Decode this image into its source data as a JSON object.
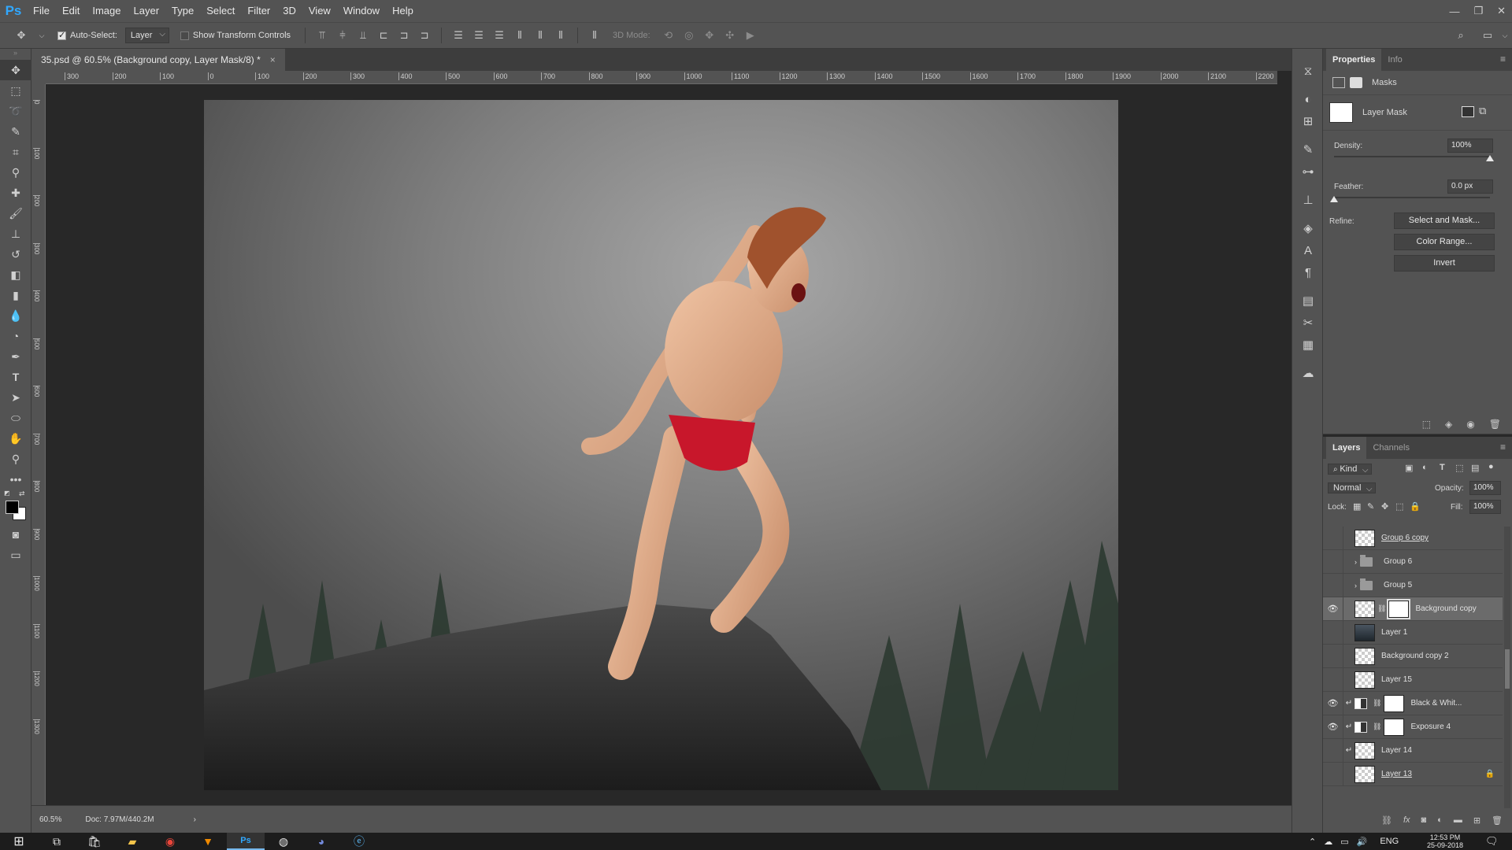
{
  "app": {
    "logo": "Ps",
    "window_controls": [
      "—",
      "❐",
      "✕"
    ]
  },
  "menu": [
    "File",
    "Edit",
    "Image",
    "Layer",
    "Type",
    "Select",
    "Filter",
    "3D",
    "View",
    "Window",
    "Help"
  ],
  "options": {
    "auto_select_label": "Auto-Select:",
    "auto_select_checked": true,
    "auto_select_target": "Layer",
    "show_transform_label": "Show Transform Controls",
    "show_transform_checked": false,
    "mode_3d_label": "3D Mode:"
  },
  "document": {
    "tab_title": "35.psd @ 60.5% (Background copy, Layer Mask/8) *",
    "close_glyph": "×",
    "zoom": "60.5%",
    "doc_size": "Doc: 7.97M/440.2M",
    "status_arrow": "›"
  },
  "ruler_h_labels": [
    "300",
    "200",
    "100",
    "0",
    "100",
    "200",
    "300",
    "400",
    "500",
    "600",
    "700",
    "800",
    "900",
    "1000",
    "1100",
    "1200",
    "1300",
    "1400",
    "1500",
    "1600",
    "1700",
    "1800",
    "1900",
    "2000",
    "2100",
    "2200"
  ],
  "ruler_v_labels": [
    "0",
    "100",
    "200",
    "300",
    "400",
    "500",
    "600",
    "700",
    "800",
    "900",
    "1000",
    "1100",
    "1200",
    "1300"
  ],
  "properties": {
    "tabs": [
      "Properties",
      "Info"
    ],
    "active_tab": "Properties",
    "section": "Masks",
    "mask_type": "Layer Mask",
    "density_label": "Density:",
    "density_value": "100%",
    "density_fraction": 1.0,
    "feather_label": "Feather:",
    "feather_value": "0.0 px",
    "feather_fraction": 0.0,
    "refine_label": "Refine:",
    "buttons": [
      "Select and Mask...",
      "Color Range...",
      "Invert"
    ]
  },
  "layers_panel": {
    "tabs": [
      "Layers",
      "Channels"
    ],
    "active_tab": "Layers",
    "filter_label": "Kind",
    "blend_mode": "Normal",
    "opacity_label": "Opacity:",
    "opacity_value": "100%",
    "lock_label": "Lock:",
    "fill_label": "Fill:",
    "fill_value": "100%",
    "layers": [
      {
        "name": "Group 6 copy",
        "visible": false,
        "kind": "layer",
        "underline": true
      },
      {
        "name": "Group 6",
        "visible": false,
        "kind": "group"
      },
      {
        "name": "Group 5",
        "visible": false,
        "kind": "group"
      },
      {
        "name": "Background copy",
        "visible": true,
        "kind": "layer-mask",
        "selected": true
      },
      {
        "name": "Layer 1",
        "visible": false,
        "kind": "layer"
      },
      {
        "name": "Background copy 2",
        "visible": false,
        "kind": "layer"
      },
      {
        "name": "Layer 15",
        "visible": false,
        "kind": "layer"
      },
      {
        "name": "Black & Whit...",
        "visible": true,
        "kind": "adjustment",
        "clipped": true
      },
      {
        "name": "Exposure 4",
        "visible": true,
        "kind": "adjustment",
        "clipped": true
      },
      {
        "name": "Layer 14",
        "visible": false,
        "kind": "layer",
        "clipped": true
      },
      {
        "name": "Layer 13",
        "visible": false,
        "kind": "layer",
        "underline": true,
        "locked": true
      }
    ]
  },
  "taskbar": {
    "language": "ENG",
    "time": "12:53 PM",
    "date": "25-09-2018"
  },
  "colors": {
    "ui_panel": "#535353",
    "ui_dark": "#282828",
    "accent": "#31a8ff",
    "sky": "#8a8a8a",
    "rock": "#2f2f2f",
    "trees": "#2e3e33",
    "briefs": "#c8172b",
    "skin": "#e2b08f",
    "hair": "#a0522d"
  }
}
